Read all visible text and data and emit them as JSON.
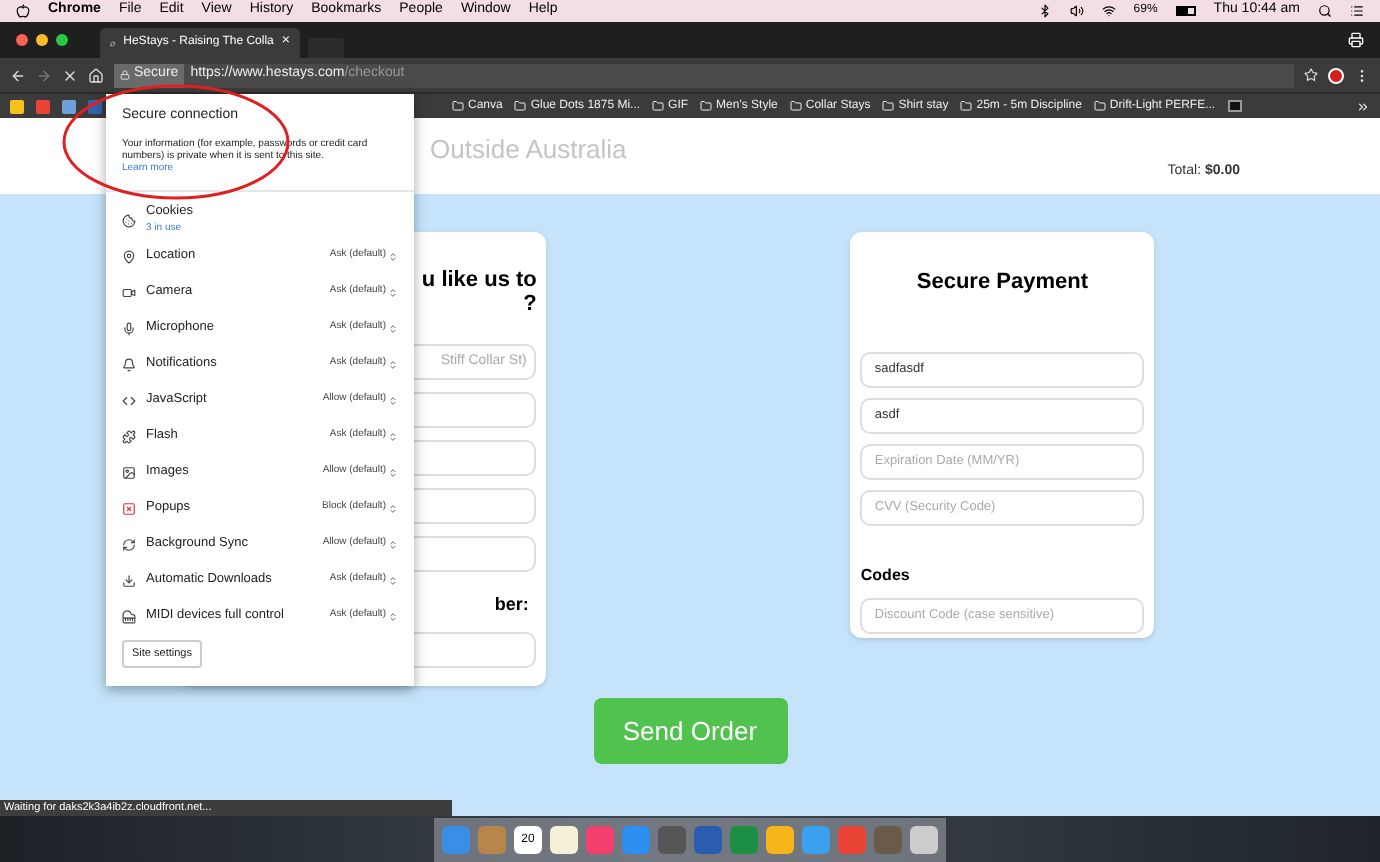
{
  "menu_bar": {
    "items": [
      "Chrome",
      "File",
      "Edit",
      "View",
      "History",
      "Bookmarks",
      "People",
      "Window",
      "Help"
    ],
    "battery": "69%",
    "clock": "Thu 10:44 am"
  },
  "tab": {
    "title": "HeStays - Raising The Colla",
    "close": "×"
  },
  "address_bar": {
    "secure_label": "Secure",
    "url_host": "https://www.hestays.com",
    "url_path": "/checkout"
  },
  "bookmarks": [
    {
      "label": "Canva"
    },
    {
      "label": "Glue Dots 1875 Mi..."
    },
    {
      "label": "GIF"
    },
    {
      "label": "Men's Style"
    },
    {
      "label": "Collar Stays"
    },
    {
      "label": "Shirt stay"
    },
    {
      "label": "25m - 5m Discipline"
    },
    {
      "label": "Drift-Light PERFE..."
    }
  ],
  "page": {
    "header_faded": "Outside Australia",
    "total_label": "Total:",
    "total_value": "$0.00",
    "left_card": {
      "heading_line_1": "u like us to",
      "heading_line_2": "?",
      "first_placeholder": "Stiff Collar St)",
      "label": "ber:"
    },
    "payment": {
      "title": "Secure Payment",
      "fields": [
        {
          "value": "sadfasdf"
        },
        {
          "value": "asdf"
        },
        {
          "placeholder": "Expiration Date (MM/YR)"
        },
        {
          "placeholder": "CVV (Security Code)"
        }
      ],
      "codes_label": "Codes",
      "discount_placeholder": "Discount Code (case sensitive)"
    },
    "send_button": "Send Order"
  },
  "site_info_popup": {
    "title": "Secure connection",
    "text": "Your information (for example, passwords or credit card numbers) is private when it is sent to this site.",
    "link": "Learn more",
    "permissions": [
      {
        "label": "Cookies",
        "sub": "3 in use"
      },
      {
        "label": "Location",
        "value": "Ask (default)"
      },
      {
        "label": "Camera",
        "value": "Ask (default)"
      },
      {
        "label": "Microphone",
        "value": "Ask (default)"
      },
      {
        "label": "Notifications",
        "value": "Ask (default)"
      },
      {
        "label": "JavaScript",
        "value": "Allow (default)"
      },
      {
        "label": "Flash",
        "value": "Ask (default)"
      },
      {
        "label": "Images",
        "value": "Allow (default)"
      },
      {
        "label": "Popups",
        "value": "Block (default)"
      },
      {
        "label": "Background Sync",
        "value": "Allow (default)"
      },
      {
        "label": "Automatic Downloads",
        "value": "Ask (default)"
      },
      {
        "label": "MIDI devices full control",
        "value": "Ask (default)"
      }
    ],
    "site_settings_button": "Site settings"
  },
  "status_bar": "Waiting for daks2k3a4ib2z.cloudfront.net...",
  "dock": {
    "calendar_day": "20"
  }
}
